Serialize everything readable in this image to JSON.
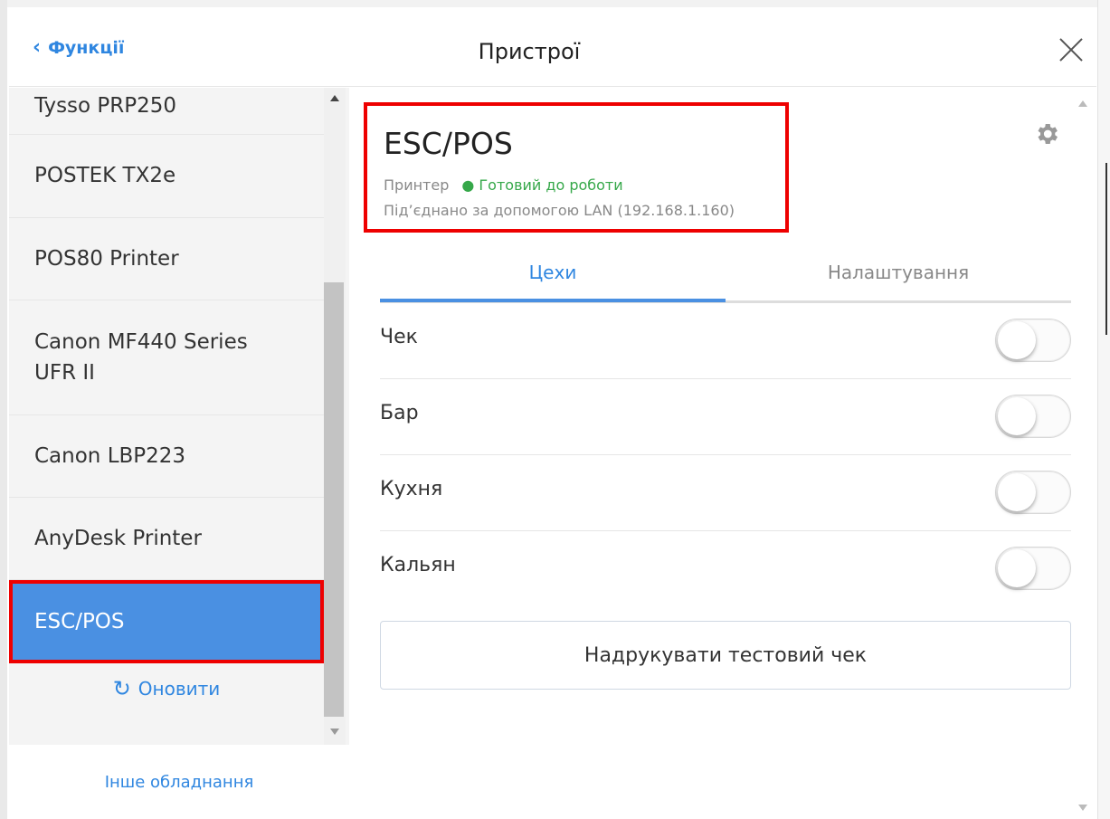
{
  "header": {
    "back_label": "Функції",
    "title": "Пристрої"
  },
  "sidebar": {
    "items": [
      {
        "label": "Tysso PRP250"
      },
      {
        "label": "POSTEK TX2e"
      },
      {
        "label": "POS80 Printer"
      },
      {
        "label": "Canon MF440 Series UFR II"
      },
      {
        "label": "Canon LBP223"
      },
      {
        "label": "AnyDesk Printer"
      },
      {
        "label": "ESC/POS",
        "selected": true
      }
    ],
    "refresh_label": "Оновити",
    "other_hardware_label": "Інше обладнання"
  },
  "device": {
    "name": "ESC/POS",
    "type": "Принтер",
    "status": "● Готовий до роботи",
    "connection": "Під’єднано за допомогою LAN (192.168.1.160)"
  },
  "tabs": [
    {
      "label": "Цехи",
      "active": true
    },
    {
      "label": "Налаштування",
      "active": false
    }
  ],
  "workshops": [
    {
      "label": "Чек",
      "enabled": false
    },
    {
      "label": "Бар",
      "enabled": false
    },
    {
      "label": "Кухня",
      "enabled": false
    },
    {
      "label": "Кальян",
      "enabled": false
    }
  ],
  "test_print_label": "Надрукувати тестовий чек",
  "colors": {
    "accent": "#4a90e2",
    "link": "#2f86e0",
    "status_ok": "#36a84a",
    "highlight": "#e00000"
  },
  "icons": {
    "back": "chevron-left-icon",
    "close": "close-icon",
    "settings": "gear-icon",
    "refresh": "refresh-icon"
  }
}
